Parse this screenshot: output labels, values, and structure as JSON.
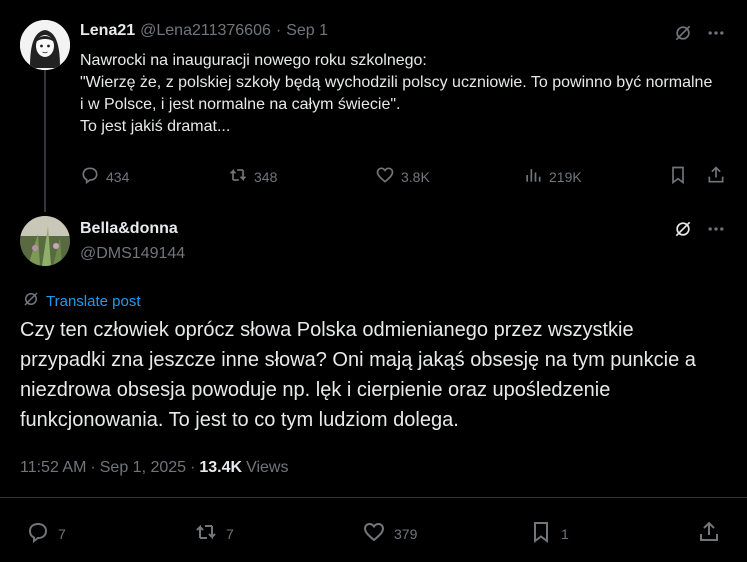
{
  "parent": {
    "display_name": "Lena21",
    "handle": "@Lena211376606",
    "date": "Sep 1",
    "text": "Nawrocki na inauguracji nowego roku szkolnego:\n\"Wierzę że, z polskiej szkoły będą wychodzili polscy uczniowie. To powinno być normalne i w Polsce, i jest normalne na całym świecie\".\nTo jest jakiś dramat...",
    "replies": "434",
    "reposts": "348",
    "likes": "3.8K",
    "views": "219K"
  },
  "reply": {
    "display_name": "Bella&donna",
    "handle": "@DMS149144",
    "translate_label": "Translate post",
    "text": "Czy ten człowiek oprócz słowa Polska odmienianego przez wszystkie przypadki zna jeszcze inne słowa? Oni mają jakąś obsesję na tym punkcie a niezdrowa obsesja powoduje np. lęk i cierpienie oraz upośledzenie funkcjonowania. To jest to co tym ludziom dolega.",
    "time": "11:52 AM",
    "date": "Sep 1, 2025",
    "views_count": "13.4K",
    "views_label": "Views",
    "replies": "7",
    "reposts": "7",
    "likes": "379",
    "bookmarks": "1"
  },
  "colors": {
    "accent": "#1d9bf0",
    "muted": "#71767b",
    "text": "#e7e9ea",
    "background": "#000000"
  },
  "icons": [
    "grok-icon",
    "more-icon",
    "reply-icon",
    "repost-icon",
    "like-icon",
    "views-icon",
    "bookmark-icon",
    "share-icon",
    "translate-icon"
  ]
}
